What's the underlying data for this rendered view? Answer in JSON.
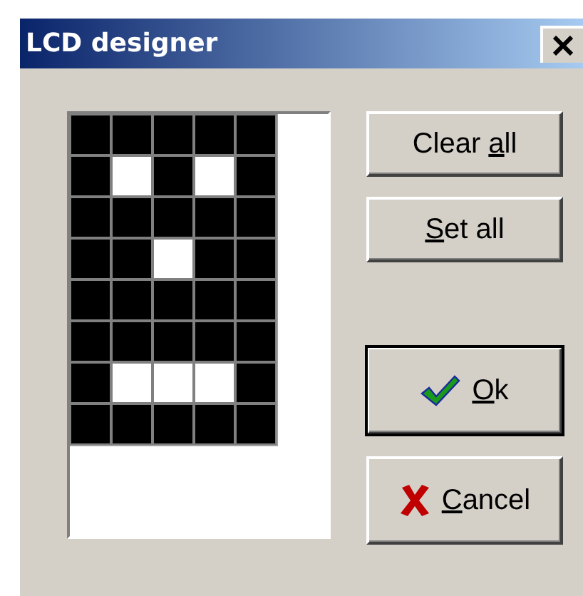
{
  "window": {
    "title": "LCD designer"
  },
  "pixels": [
    [
      {
        "on": true
      },
      {
        "on": true
      },
      {
        "on": true
      },
      {
        "on": true
      },
      {
        "on": true
      }
    ],
    [
      {
        "on": true
      },
      {
        "on": false
      },
      {
        "on": true
      },
      {
        "on": false
      },
      {
        "on": true
      }
    ],
    [
      {
        "on": true
      },
      {
        "on": true
      },
      {
        "on": true
      },
      {
        "on": true
      },
      {
        "on": true
      }
    ],
    [
      {
        "on": true
      },
      {
        "on": true
      },
      {
        "on": false
      },
      {
        "on": true
      },
      {
        "on": true
      }
    ],
    [
      {
        "on": true
      },
      {
        "on": true
      },
      {
        "on": true
      },
      {
        "on": true
      },
      {
        "on": true
      }
    ],
    [
      {
        "on": true
      },
      {
        "on": true
      },
      {
        "on": true
      },
      {
        "on": true
      },
      {
        "on": true
      }
    ],
    [
      {
        "on": true
      },
      {
        "on": false
      },
      {
        "on": false
      },
      {
        "on": false
      },
      {
        "on": true
      }
    ],
    [
      {
        "on": true
      },
      {
        "on": true
      },
      {
        "on": true
      },
      {
        "on": true
      },
      {
        "on": true
      }
    ]
  ],
  "buttons": [
    {
      "label_before_key": "Clear ",
      "access_key": "a",
      "label_after_key": "ll",
      "kind": "plain",
      "default": false
    },
    {
      "access_key": "S",
      "label_after_key": "et all",
      "kind": "plain",
      "default": false
    },
    {
      "access_key": "O",
      "label_after_key": "k",
      "kind": "ok",
      "default": true
    },
    {
      "access_key": "C",
      "label_after_key": "ancel",
      "kind": "cancel",
      "default": false
    }
  ]
}
